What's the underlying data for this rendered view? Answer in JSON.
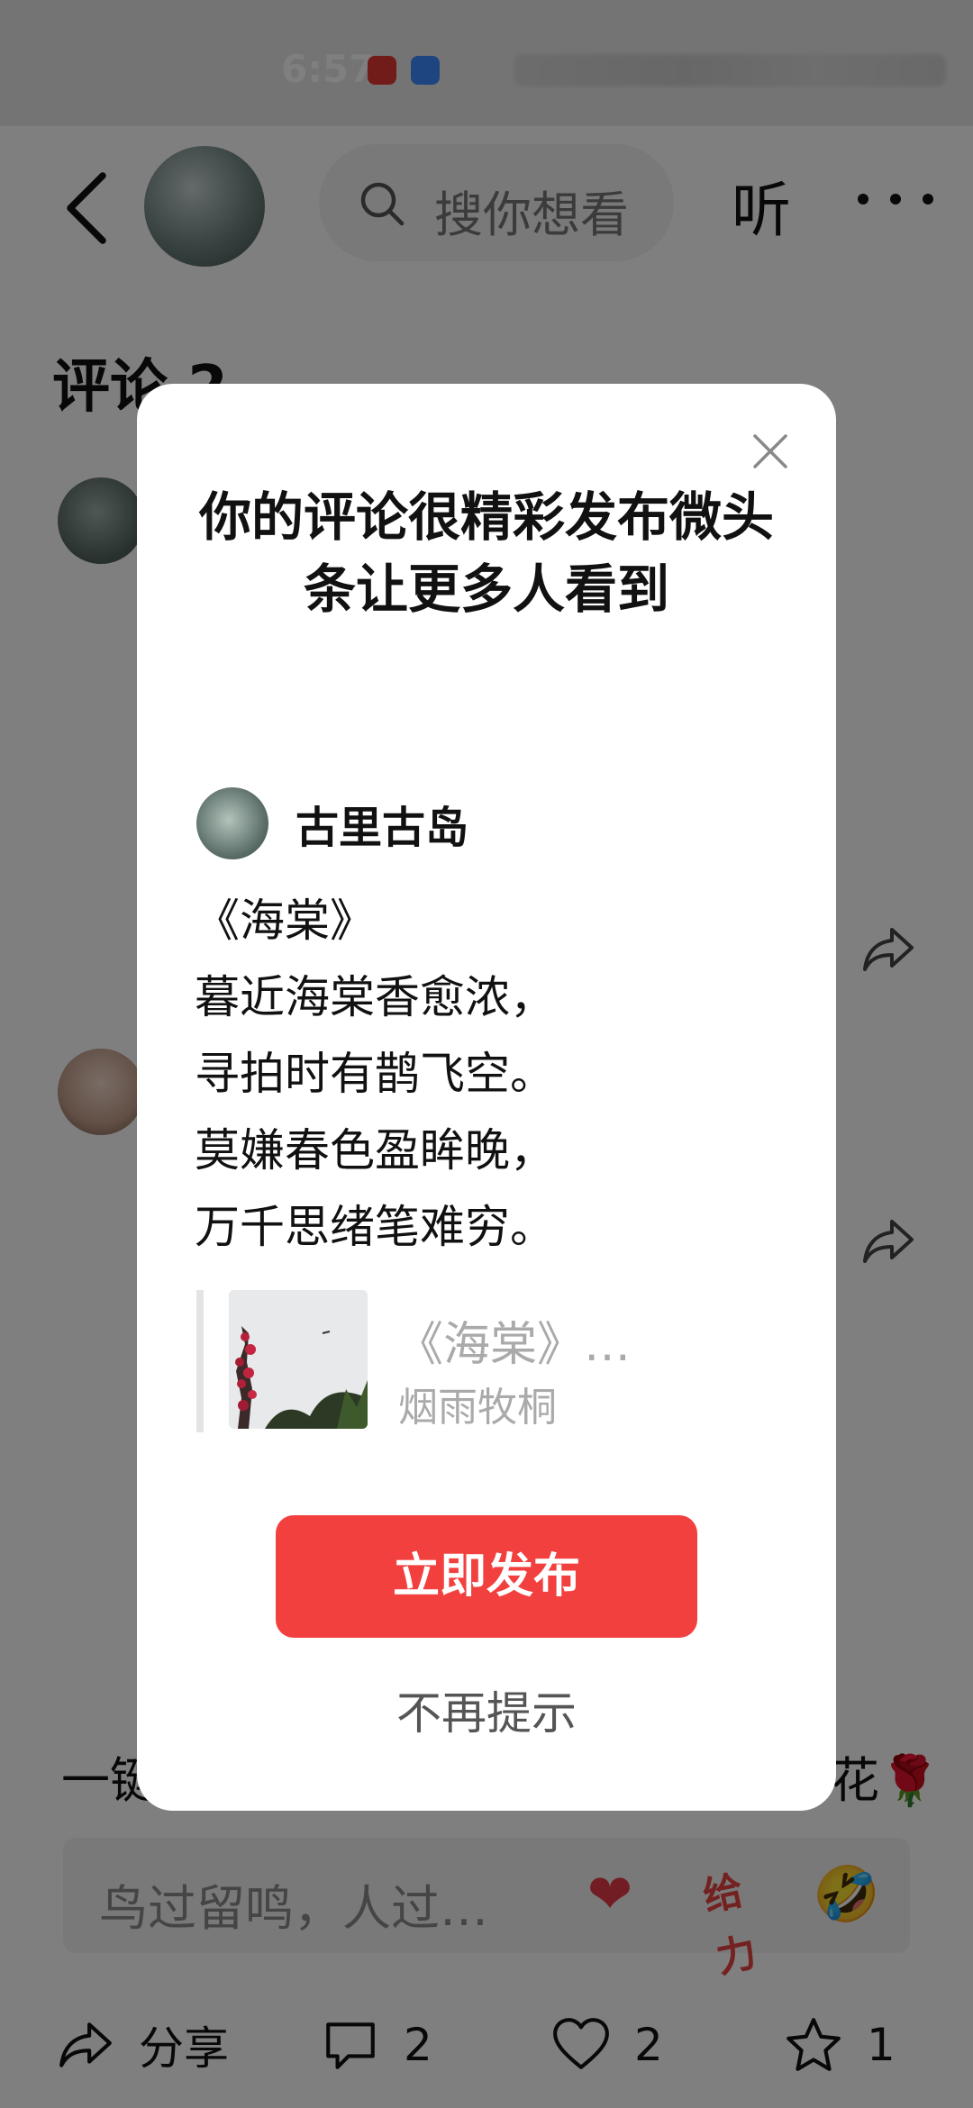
{
  "status_bar": {
    "time": "6:57"
  },
  "top_nav": {
    "search_placeholder": "搜你想看",
    "listen_label": "听"
  },
  "comments": {
    "title": "评论 2"
  },
  "footer_strip": {
    "left_text": "一键",
    "right_text": "花",
    "right_emoji": "🌹"
  },
  "input_bar": {
    "placeholder": "鸟过留鸣，人过…",
    "heart": "❤",
    "jiayou": "给力",
    "laugh": "🤣"
  },
  "bottom_bar": {
    "share_label": "分享",
    "comment_count": "2",
    "like_count": "2",
    "fav_count": "1"
  },
  "dialog": {
    "headline": "你的评论很精彩发布微头条让更多人看到",
    "author_name": "古里古岛",
    "poem": [
      "《海棠》",
      "暮近海棠香愈浓，",
      "寻拍时有鹊飞空。",
      "莫嫌春色盈眸晚，",
      "万千思绪笔难穷。"
    ],
    "quote_title": "《海棠》…",
    "quote_author": "烟雨牧桐",
    "publish_label": "立即发布",
    "dismiss_label": "不再提示"
  },
  "colors": {
    "accent": "#f2403f",
    "overlay": "rgba(0,0,0,0.5)"
  }
}
